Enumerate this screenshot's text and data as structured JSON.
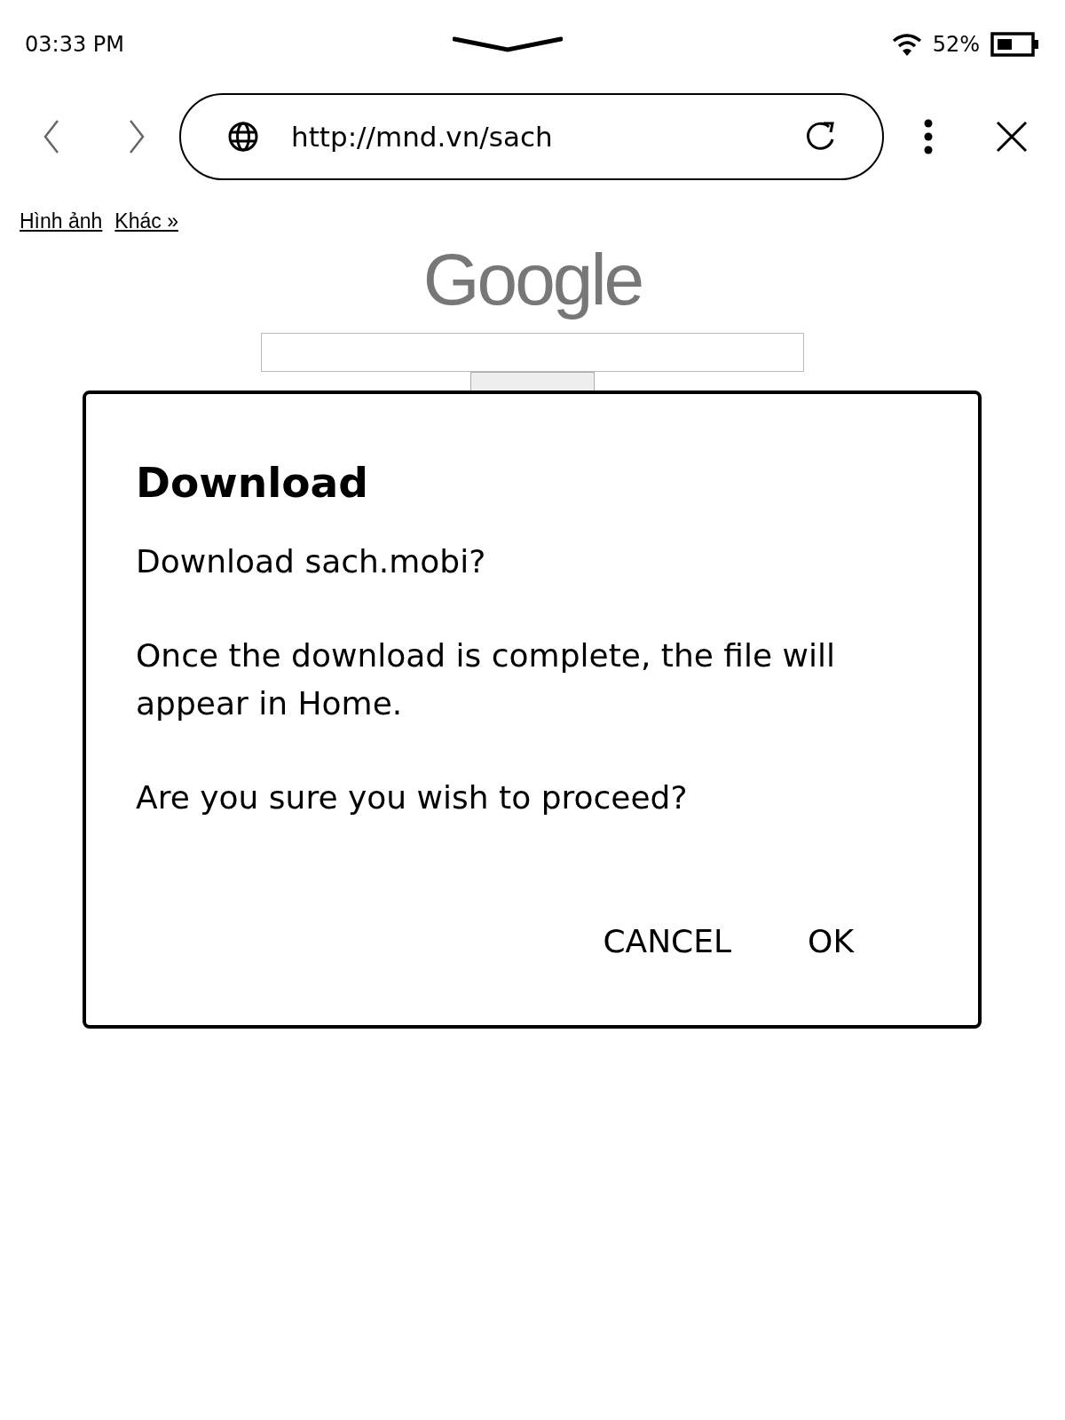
{
  "status_bar": {
    "time": "03:33 PM",
    "battery": "52%"
  },
  "browser": {
    "url": "http://mnd.vn/sach"
  },
  "page": {
    "links": [
      "Hình ảnh",
      "Khác »"
    ],
    "logo": "Google"
  },
  "dialog": {
    "title": "Download",
    "paragraphs": [
      "Download sach.mobi?",
      "Once the download is complete, the file will appear in Home.",
      "Are you sure you wish to proceed?"
    ],
    "buttons": [
      "CANCEL",
      "OK"
    ]
  }
}
